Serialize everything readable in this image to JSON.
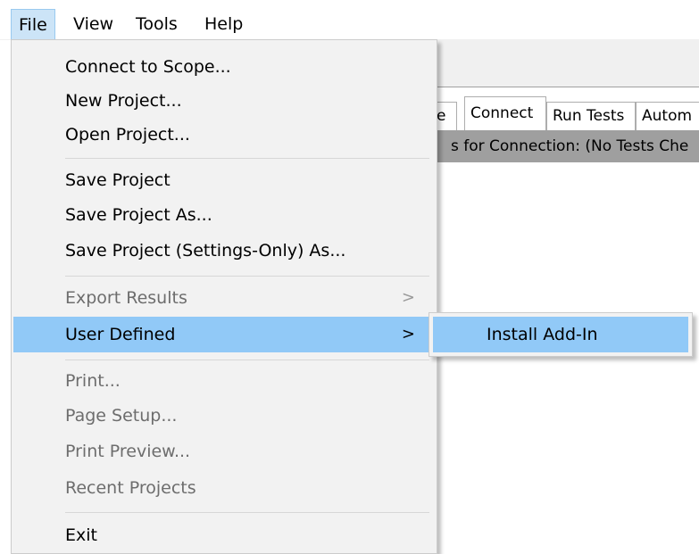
{
  "menubar": {
    "items": [
      {
        "label": "File",
        "open": true
      },
      {
        "label": "View"
      },
      {
        "label": "Tools"
      },
      {
        "label": "Help"
      }
    ]
  },
  "background": {
    "tabs": [
      {
        "label": "e"
      },
      {
        "label": "Connect",
        "active": true
      },
      {
        "label": "Run Tests"
      },
      {
        "label": "Autom"
      }
    ],
    "tests_bar_text": "s for Connection: (No Tests Che"
  },
  "file_menu": {
    "items": [
      {
        "label": "Connect to Scope...",
        "enabled": true
      },
      {
        "label": "New Project...",
        "enabled": true
      },
      {
        "label": "Open Project...",
        "enabled": true
      },
      {
        "label": "Save Project",
        "enabled": true
      },
      {
        "label": "Save Project As...",
        "enabled": true
      },
      {
        "label": "Save Project (Settings-Only) As...",
        "enabled": true
      },
      {
        "label": "Export Results",
        "enabled": false,
        "submenu_arrow": ">"
      },
      {
        "label": "User Defined",
        "enabled": true,
        "highlighted": true,
        "submenu_arrow": ">"
      },
      {
        "label": "Print...",
        "enabled": false
      },
      {
        "label": "Page Setup...",
        "enabled": false
      },
      {
        "label": "Print Preview...",
        "enabled": false
      },
      {
        "label": "Recent Projects",
        "enabled": false
      },
      {
        "label": "Exit",
        "enabled": true
      }
    ]
  },
  "user_defined_submenu": {
    "items": [
      {
        "label": "Install Add-In",
        "highlighted": true
      }
    ]
  }
}
